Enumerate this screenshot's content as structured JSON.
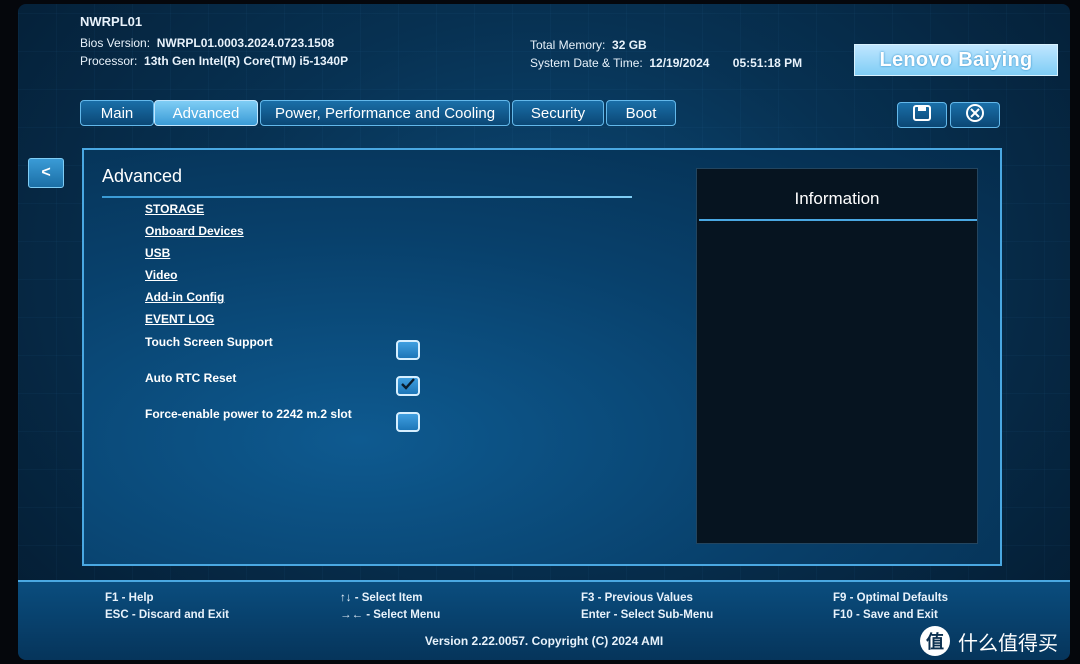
{
  "header": {
    "model": "NWRPL01",
    "bios_label": "Bios Version:",
    "bios_value": "NWRPL01.0003.2024.0723.1508",
    "processor_label": "Processor:",
    "processor_value": "13th Gen Intel(R) Core(TM) i5-1340P",
    "memory_label": "Total Memory:",
    "memory_value": "32 GB",
    "datetime_label": "System Date & Time:",
    "date_value": "12/19/2024",
    "time_value": "05:51:18 PM"
  },
  "logo": {
    "text": "Lenovo Baiying"
  },
  "tabs": [
    {
      "label": "Main",
      "active": false
    },
    {
      "label": "Advanced",
      "active": true
    },
    {
      "label": "Power, Performance and Cooling",
      "active": false
    },
    {
      "label": "Security",
      "active": false
    },
    {
      "label": "Boot",
      "active": false
    }
  ],
  "toolbar": {
    "save_icon": "save-icon",
    "exit_icon": "close-circle-icon"
  },
  "back_button": {
    "label": "<"
  },
  "section": {
    "title": "Advanced",
    "links": [
      "STORAGE",
      "Onboard Devices",
      "USB",
      "Video",
      "Add-in Config",
      "EVENT LOG"
    ],
    "options": [
      {
        "label": "Touch Screen Support",
        "checked": false
      },
      {
        "label": "Auto RTC Reset",
        "checked": true
      },
      {
        "label": "Force-enable power to 2242 m.2 slot",
        "checked": false
      }
    ]
  },
  "info_panel": {
    "title": "Information"
  },
  "footer": {
    "keys": [
      {
        "line1": "F1 - Help",
        "line2": "ESC - Discard and Exit"
      },
      {
        "line1": "↑↓ - Select Item",
        "line2": "→← - Select Menu"
      },
      {
        "line1": "F3 - Previous Values",
        "line2": "Enter - Select Sub-Menu"
      },
      {
        "line1": "F9 - Optimal Defaults",
        "line2": "F10 - Save and Exit"
      }
    ],
    "version": "Version 2.22.0057. Copyright (C) 2024 AMI"
  },
  "watermark": {
    "glyph": "值",
    "text": "什么值得买"
  }
}
